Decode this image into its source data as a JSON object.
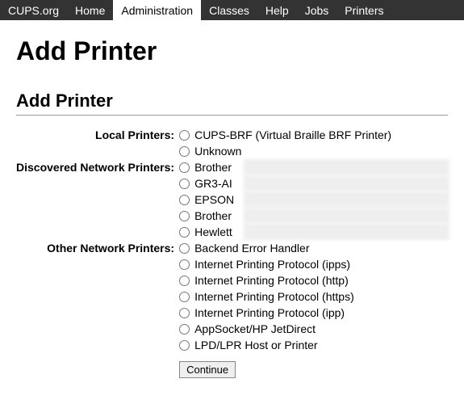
{
  "nav": {
    "items": [
      {
        "label": "CUPS.org"
      },
      {
        "label": "Home"
      },
      {
        "label": "Administration"
      },
      {
        "label": "Classes"
      },
      {
        "label": "Help"
      },
      {
        "label": "Jobs"
      },
      {
        "label": "Printers"
      }
    ],
    "active_index": 2
  },
  "page": {
    "title": "Add Printer",
    "section_title": "Add Printer"
  },
  "groups": {
    "local": {
      "label": "Local Printers:",
      "options": [
        {
          "label": "CUPS-BRF (Virtual Braille BRF Printer)"
        },
        {
          "label": "Unknown"
        }
      ]
    },
    "discovered": {
      "label": "Discovered Network Printers:",
      "options": [
        {
          "label": "Brother",
          "obscured": true
        },
        {
          "label": "GR3-AI",
          "obscured": true
        },
        {
          "label": "EPSON",
          "obscured": true
        },
        {
          "label": "Brother",
          "obscured": true
        },
        {
          "label": "Hewlett",
          "obscured": true
        }
      ]
    },
    "other": {
      "label": "Other Network Printers:",
      "options": [
        {
          "label": "Backend Error Handler"
        },
        {
          "label": "Internet Printing Protocol (ipps)"
        },
        {
          "label": "Internet Printing Protocol (http)"
        },
        {
          "label": "Internet Printing Protocol (https)"
        },
        {
          "label": "Internet Printing Protocol (ipp)"
        },
        {
          "label": "AppSocket/HP JetDirect"
        },
        {
          "label": "LPD/LPR Host or Printer"
        }
      ]
    }
  },
  "actions": {
    "continue": "Continue"
  }
}
